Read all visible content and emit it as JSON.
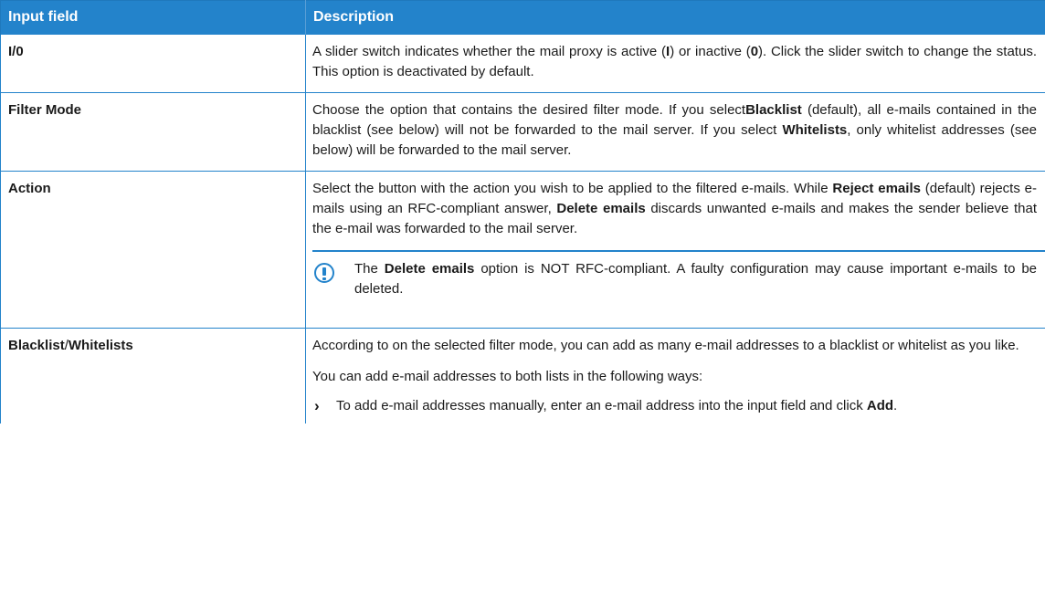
{
  "header": {
    "col1": "Input field",
    "col2": "Description"
  },
  "rows": {
    "r0": {
      "field": "I/0",
      "d1": "A slider switch indicates whether the mail proxy is active (",
      "b1": "I",
      "d2": ") or inactive (",
      "b2": "0",
      "d3": "). Click the slider switch to change the status. This option is deactivated by default."
    },
    "r1": {
      "field": "Filter Mode",
      "d1": "Choose the option that contains the desired filter mode. If you select",
      "b1": "Blacklist",
      "d2": " (default), all e-mails contained in the blacklist (see below) will not be forwarded to the mail server. If you select ",
      "b2": "Whitelists",
      "d3": ", only whitelist addresses (see below) will be forwarded to the mail server."
    },
    "r2": {
      "field": "Action",
      "d1": "Select the button with the action you wish to be applied to the filtered e-mails. While ",
      "b1": "Reject emails",
      "d2": " (default) rejects e-mails using an RFC-compliant answer, ",
      "b2": "Delete emails",
      "d3": " discards unwanted e-mails and makes the sender believe that the e-mail was forwarded to the mail server.",
      "note": {
        "icon": "info-exclamation-icon",
        "t1": "The ",
        "b1": "Delete emails",
        "t2": " option is NOT RFC-compliant. A faulty configuration may cause important e-mails to be deleted."
      }
    },
    "r3": {
      "field_a": "Blacklist",
      "field_sep": "/",
      "field_b": "Whitelists",
      "p1": "According to on the selected filter mode, you can add as many e-mail addresses to a blacklist or whitelist as you like.",
      "p2": "You can add e-mail addresses to both lists in the following ways:",
      "bullet": {
        "icon": "chevron-right-icon",
        "t1": "To add e-mail addresses manually, enter an e-mail address into the input field and click ",
        "b1": "Add",
        "t2": "."
      }
    }
  }
}
